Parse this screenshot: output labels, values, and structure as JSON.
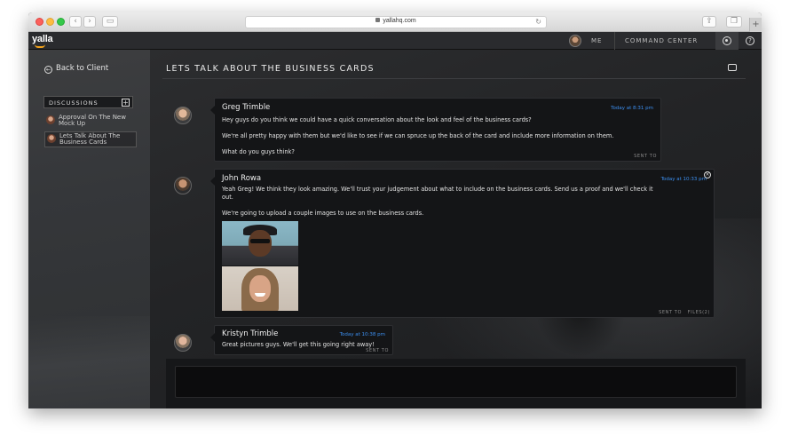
{
  "browser": {
    "url": "yallahq.com"
  },
  "app": {
    "logo": "yalla",
    "me_label": "ME",
    "command_center_label": "COMMAND CENTER"
  },
  "sidebar": {
    "back_label": "Back to Client",
    "discussions_label": "DISCUSSIONS",
    "items": [
      {
        "label": "Approval On The New Mock Up"
      },
      {
        "label": "Lets Talk About The Business Cards"
      }
    ]
  },
  "thread": {
    "title": "LETS TALK ABOUT THE BUSINESS CARDS",
    "messages": [
      {
        "author": "Greg Trimble",
        "time": "Today at 8:31 pm",
        "lines": [
          "Hey guys do you think we could have a quick conversation about the look and feel of the business cards?",
          "We're all pretty happy with them but we'd like to see if we can spruce up the back of the card and include more information on them.",
          "What do you guys think?"
        ],
        "sent_to": "SENT TO"
      },
      {
        "author": "John Rowa",
        "time": "Today at 10:33 pm",
        "lines": [
          "Yeah Greg! We think they look amazing. We'll trust your judgement about what to include on the business cards. Send us a proof and we'll check it",
          "out.",
          "We're going to upload a couple images to use on the business cards."
        ],
        "sent_to": "SENT TO",
        "files": "FILES(2)"
      },
      {
        "author": "Kristyn Trimble",
        "time": "Today at 10:38 pm",
        "lines": [
          "Great pictures guys. We'll get this going right away!"
        ],
        "sent_to": "SENT TO"
      }
    ]
  }
}
